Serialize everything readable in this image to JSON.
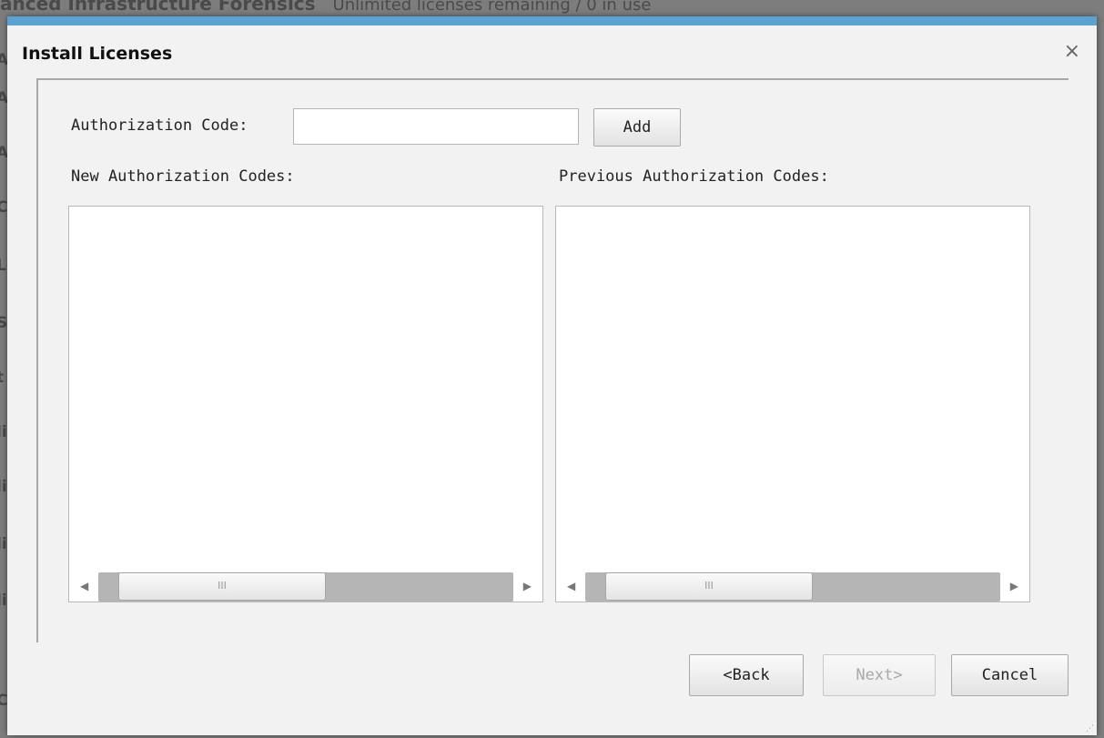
{
  "background": {
    "header_title": "anced Infrastructure Forensics",
    "header_subtitle": "Unlimited licenses remaining / 0 in use",
    "letters": [
      "A",
      "A",
      "A",
      "C",
      "L",
      "S",
      "t",
      "li",
      "li",
      "li",
      "li",
      "C"
    ]
  },
  "dialog": {
    "title": "Install Licenses",
    "close_symbol": "×",
    "auth_code_label": "Authorization Code:",
    "auth_code_value": "",
    "add_label": "Add",
    "new_codes_label": "New Authorization Codes:",
    "previous_codes_label": "Previous Authorization Codes:",
    "new_codes": [],
    "previous_codes": [],
    "scroll_thumb_grip": "III",
    "back_label": "<Back",
    "next_label": "Next>",
    "cancel_label": "Cancel"
  },
  "colors": {
    "title_bar_accent": "#5aa2d4",
    "dialog_bg": "#f2f2f2"
  }
}
